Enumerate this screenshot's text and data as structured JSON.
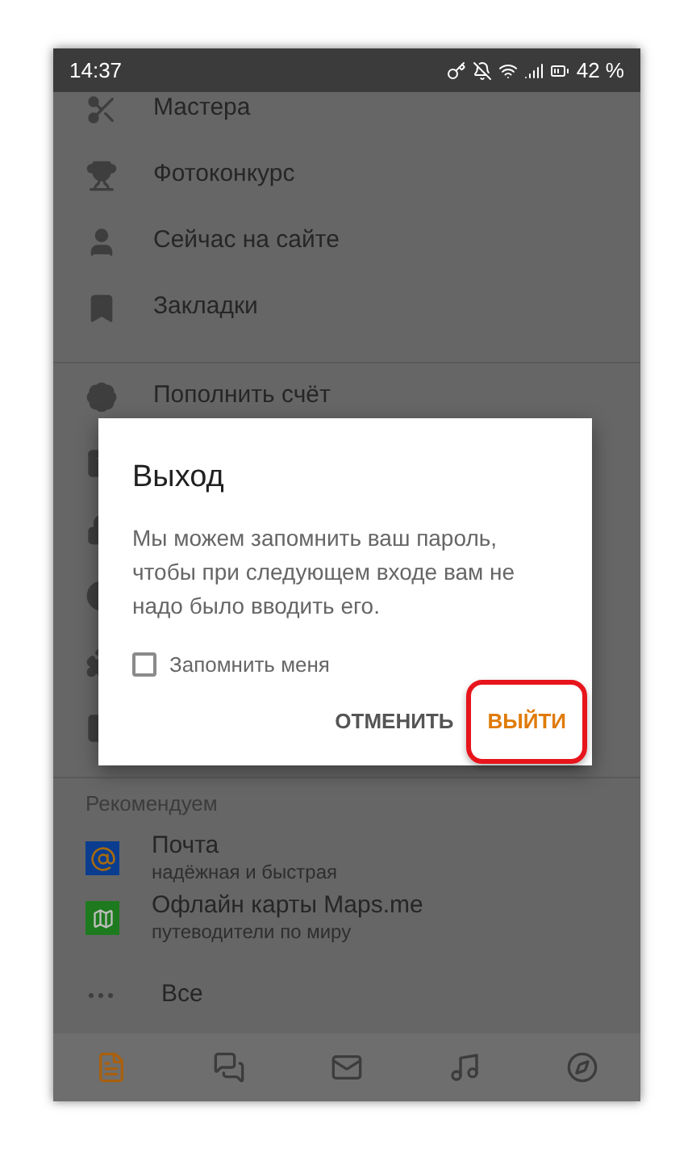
{
  "status_bar": {
    "time": "14:37",
    "battery": "42 %"
  },
  "menu": [
    {
      "label": "Мастера"
    },
    {
      "label": "Фотоконкурс"
    },
    {
      "label": "Сейчас на сайте"
    },
    {
      "label": "Закладки"
    }
  ],
  "menu2": [
    {
      "label": "Пополнить счёт"
    }
  ],
  "recommended": {
    "title": "Рекомендуем",
    "items": [
      {
        "title": "Почта",
        "subtitle": "надёжная и быстрая",
        "color": "#0a3d8f"
      },
      {
        "title": "Офлайн карты Maps.me",
        "subtitle": "путеводители по миру",
        "color": "#1e7a1e"
      }
    ],
    "all": "Все"
  },
  "bottom_nav": [
    {
      "selected": true
    },
    {
      "selected": false
    },
    {
      "selected": false
    },
    {
      "selected": false
    },
    {
      "selected": false
    }
  ],
  "dialog": {
    "title": "Выход",
    "message": "Мы можем запомнить ваш пароль, чтобы при следующем входе вам не надо было вводить его.",
    "checkbox": {
      "label": "Запомнить меня",
      "checked": false
    },
    "buttons": [
      {
        "label": "ОТМЕНИТЬ",
        "kind": "secondary",
        "highlighted": false
      },
      {
        "label": "ВЫЙТИ",
        "kind": "primary",
        "highlighted": true
      }
    ]
  }
}
